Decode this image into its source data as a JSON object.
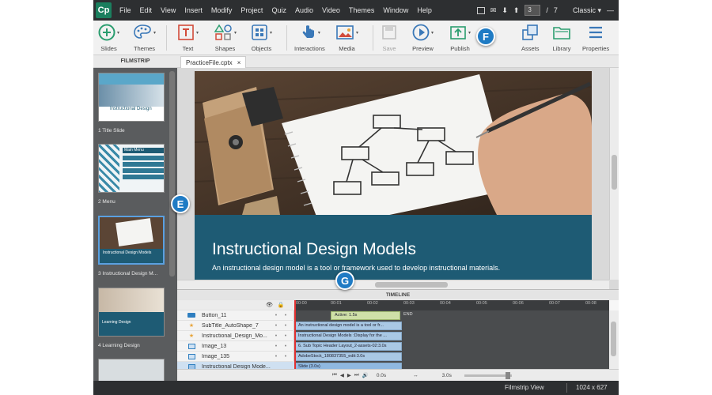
{
  "app": {
    "logo": "Cp"
  },
  "menu": [
    "File",
    "Edit",
    "View",
    "Insert",
    "Modify",
    "Project",
    "Quiz",
    "Audio",
    "Video",
    "Themes",
    "Window",
    "Help"
  ],
  "menu_right": {
    "current_page": "3",
    "page_separator": "/",
    "total_pages": "7",
    "workspace": "Classic"
  },
  "toolbar": [
    {
      "label": "Slides",
      "icon": "plus-circle-icon"
    },
    {
      "label": "Themes",
      "icon": "palette-icon"
    },
    {
      "label": "Text",
      "icon": "text-box-icon"
    },
    {
      "label": "Shapes",
      "icon": "shapes-icon"
    },
    {
      "label": "Objects",
      "icon": "objects-icon"
    },
    {
      "label": "Interactions",
      "icon": "hand-pointer-icon"
    },
    {
      "label": "Media",
      "icon": "image-icon"
    },
    {
      "label": "Save",
      "icon": "save-icon"
    },
    {
      "label": "Preview",
      "icon": "play-icon"
    },
    {
      "label": "Publish",
      "icon": "publish-icon"
    },
    {
      "label": "Assets",
      "icon": "assets-icon"
    },
    {
      "label": "Library",
      "icon": "folder-icon"
    },
    {
      "label": "Properties",
      "icon": "list-icon"
    }
  ],
  "filmstrip": {
    "header": "FILMSTRIP",
    "slides": [
      {
        "caption": "1 Title Slide",
        "thumb_title": "Instructional Design"
      },
      {
        "caption": "2 Menu",
        "thumb_title": "Main Menu"
      },
      {
        "caption": "3 Instructional Design M...",
        "thumb_title": "Instructional Design Models"
      },
      {
        "caption": "4 Learning Design",
        "thumb_title": "Learning Design"
      }
    ]
  },
  "tab": {
    "name": "PracticeFile.cptx",
    "close": "×"
  },
  "slide": {
    "title": "Instructional Design Models",
    "subtitle": "An instructional design model is a tool or framework used to develop instructional materials."
  },
  "timeline": {
    "header": "TIMELINE",
    "ticks": [
      "00:00",
      "00:01",
      "00:02",
      "00:03",
      "00:04",
      "00:05",
      "00:06",
      "00:07",
      "00:08"
    ],
    "end_label": "END",
    "rows": [
      {
        "name": "Button_11",
        "icon": "button-icon",
        "bar": "Active: 1.5s"
      },
      {
        "name": "SubTitle_AutoShape_7",
        "icon": "star-icon",
        "bar": "An instructional design model is a tool or fr..."
      },
      {
        "name": "Instructional_Design_Mo...",
        "icon": "star-icon",
        "bar": "Instructional Design Models :Display for the ..."
      },
      {
        "name": "Image_13",
        "icon": "image-icon",
        "bar": "6. Sub Topic Header Layout_2-assets-02:3.0s"
      },
      {
        "name": "Image_135",
        "icon": "image-icon",
        "bar": "AdobeStock_180837355_edit:3.0s"
      },
      {
        "name": "Instructional Design Mode...",
        "icon": "slide-icon",
        "bar": "Slide (3.0s)"
      }
    ],
    "controls": {
      "time": "0.0s",
      "duration": "3.0s"
    }
  },
  "status": {
    "view": "Filmstrip View",
    "size": "1024 x 627"
  },
  "callouts": {
    "e": "E",
    "f": "F",
    "g": "G"
  },
  "colors": {
    "accent": "#1f7bc4",
    "slide_band": "#1e5b74",
    "app_dark": "#2d2f31"
  }
}
